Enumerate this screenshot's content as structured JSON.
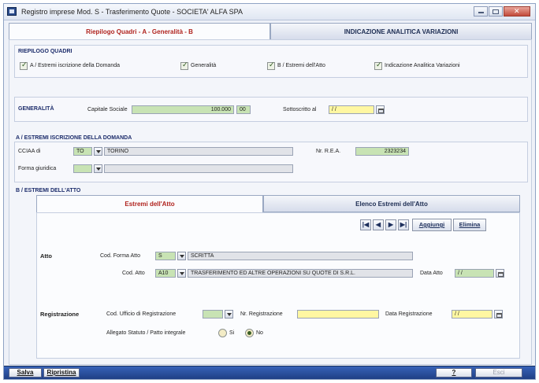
{
  "window": {
    "title": "Registro imprese Mod. S - Trasferimento Quote - SOCIETA' ALFA SPA"
  },
  "tabs": [
    {
      "label": "Riepilogo Quadri - A - Generalità - B",
      "active": true
    },
    {
      "label": "INDICAZIONE ANALITICA VARIAZIONI",
      "active": false
    }
  ],
  "riepilogo": {
    "title": "RIEPILOGO QUADRI",
    "items": [
      {
        "label": "A / Estremi iscrizione della Domanda",
        "checked": true
      },
      {
        "label": "Generalità",
        "checked": true
      },
      {
        "label": "B / Estremi dell'Atto",
        "checked": true
      },
      {
        "label": "Indicazione Analitica Variazioni",
        "checked": true
      }
    ]
  },
  "generalita": {
    "title": "GENERALITÀ",
    "capitale_label": "Capitale Sociale",
    "capitale_value": "100.000",
    "capitale_decimals": "00",
    "sottoscritto_label": "Sottoscritto al",
    "sottoscritto_value": "/ /"
  },
  "sezione_a": {
    "title": "A / ESTREMI ISCRIZIONE DELLA DOMANDA",
    "cciaa_label": "CCIAA di",
    "cciaa_code": "TO",
    "cciaa_name": "TORINO",
    "rea_label": "Nr. R.E.A.",
    "rea_value": "2323234",
    "forma_label": "Forma giuridica",
    "forma_code": "",
    "forma_desc": ""
  },
  "sezione_b": {
    "title": "B / ESTREMI DELL'ATTO",
    "tabs": [
      {
        "label": "Estremi dell'Atto",
        "active": true
      },
      {
        "label": "Elenco Estremi dell'Atto",
        "active": false
      }
    ],
    "nav": {
      "first": "|◀",
      "prev": "◀",
      "next": "▶",
      "last": "▶|",
      "add_label": "Aggiungi",
      "delete_label": "Elimina"
    },
    "atto": {
      "label": "Atto",
      "forma_label": "Cod. Forma Atto",
      "forma_code": "S",
      "forma_desc": "SCRITTA",
      "cod_label": "Cod. Atto",
      "cod_code": "A10",
      "cod_desc": "TRASFERIMENTO ED ALTRE OPERAZIONI SU QUOTE DI S.R.L.",
      "data_label": "Data Atto",
      "data_value": "/ /"
    },
    "registrazione": {
      "label": "Registrazione",
      "ufficio_label": "Cod. Ufficio di Registrazione",
      "ufficio_value": "",
      "nr_label": "Nr. Registrazione",
      "nr_value": "",
      "data_label": "Data Registrazione",
      "data_value": "/ /",
      "allegato_label": "Allegato Statuto / Patto integrale",
      "options": [
        "Si",
        "No"
      ],
      "selected": "No"
    }
  },
  "bottom": {
    "save_label": "Salva",
    "restore_label": "Ripristina",
    "help_label": "?",
    "exit_label": "Esci"
  }
}
